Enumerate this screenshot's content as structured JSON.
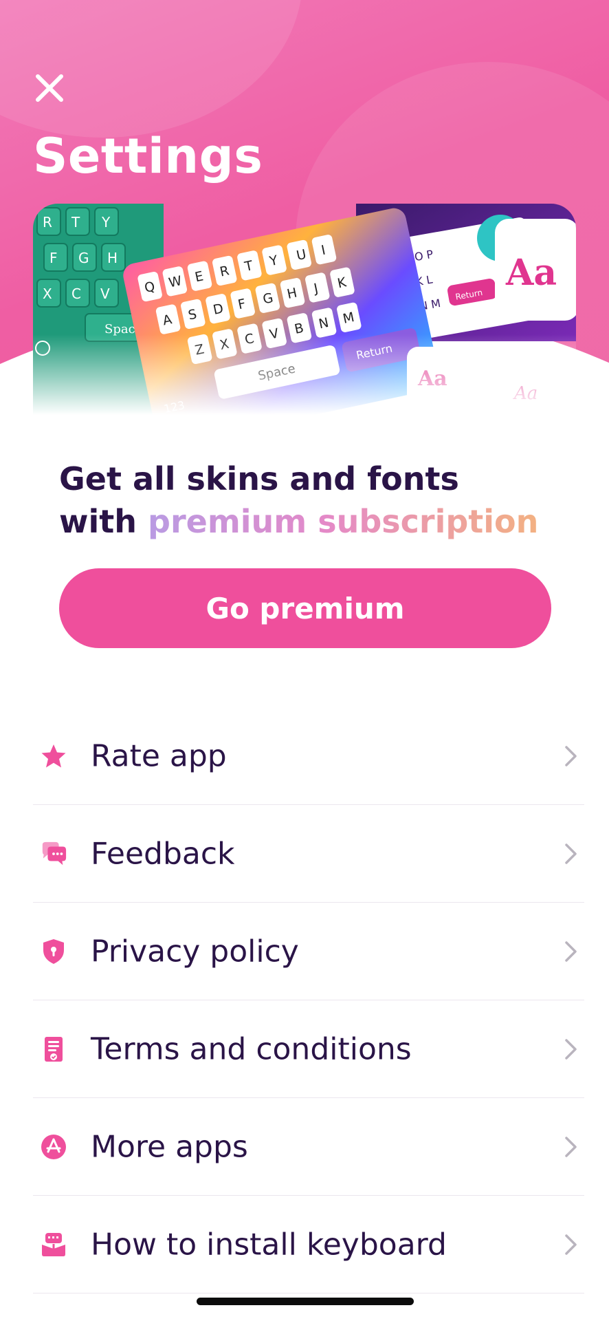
{
  "header": {
    "title": "Settings",
    "close_icon": "close-icon"
  },
  "banner": {
    "keyboard_keys_row1": [
      "Q",
      "W",
      "E",
      "R",
      "T",
      "Y",
      "U",
      "I",
      "O",
      "P"
    ],
    "keyboard_keys_row2": [
      "A",
      "S",
      "D",
      "F",
      "G",
      "H",
      "J",
      "K",
      "L"
    ],
    "keyboard_keys_row3": [
      "Z",
      "X",
      "C",
      "V",
      "B",
      "N",
      "M"
    ],
    "space_label": "Space",
    "return_label": "Return",
    "numbers_label": "123",
    "font_sample": "Aa"
  },
  "promo": {
    "line1": "Get all skins and fonts",
    "line2_prefix": "with ",
    "line2_highlight": "premium subscription",
    "button_label": "Go premium"
  },
  "menu": {
    "items": [
      {
        "label": "Rate app",
        "icon": "star-icon"
      },
      {
        "label": "Feedback",
        "icon": "chat-bubbles-icon"
      },
      {
        "label": "Privacy policy",
        "icon": "shield-icon"
      },
      {
        "label": "Terms and conditions",
        "icon": "document-icon"
      },
      {
        "label": "More apps",
        "icon": "app-store-icon"
      },
      {
        "label": "How to install keyboard",
        "icon": "keyboard-install-icon"
      }
    ]
  },
  "colors": {
    "accent": "#ef4f9c",
    "text_dark": "#2a1447",
    "chevron": "#b9b4be"
  }
}
